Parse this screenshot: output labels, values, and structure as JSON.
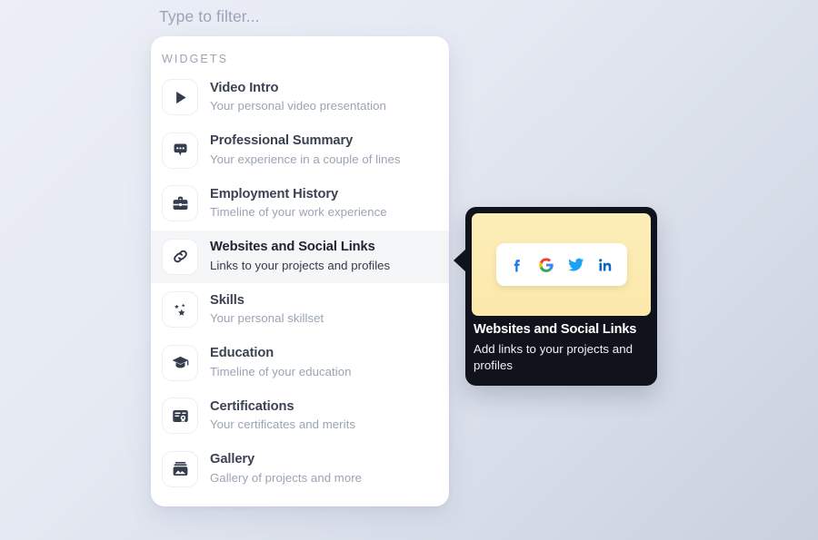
{
  "filter": {
    "placeholder": "Type to filter...",
    "value": ""
  },
  "panel": {
    "heading": "WIDGETS",
    "items": [
      {
        "icon": "play-icon",
        "title": "Video Intro",
        "subtitle": "Your personal video presentation",
        "selected": false
      },
      {
        "icon": "speech-bubble-icon",
        "title": "Professional Summary",
        "subtitle": "Your experience in a couple of lines",
        "selected": false
      },
      {
        "icon": "briefcase-icon",
        "title": "Employment History",
        "subtitle": "Timeline of your work experience",
        "selected": false
      },
      {
        "icon": "link-icon",
        "title": "Websites and Social Links",
        "subtitle": "Links to your projects and profiles",
        "selected": true
      },
      {
        "icon": "sparkle-stars-icon",
        "title": "Skills",
        "subtitle": "Your personal skillset",
        "selected": false
      },
      {
        "icon": "graduation-cap-icon",
        "title": "Education",
        "subtitle": "Timeline of your education",
        "selected": false
      },
      {
        "icon": "certificate-icon",
        "title": "Certifications",
        "subtitle": "Your certificates and merits",
        "selected": false
      },
      {
        "icon": "gallery-image-icon",
        "title": "Gallery",
        "subtitle": "Gallery of projects and more",
        "selected": false
      }
    ]
  },
  "preview": {
    "title": "Websites and Social Links",
    "description": "Add links to your projects and profiles",
    "social_icons": [
      {
        "name": "facebook-icon",
        "label": "f",
        "color": "#1877F2"
      },
      {
        "name": "google-icon",
        "label": "G",
        "color": "#4285F4"
      },
      {
        "name": "twitter-icon",
        "label": "twitter bird",
        "color": "#1DA1F2"
      },
      {
        "name": "linkedin-icon",
        "label": "in",
        "color": "#0A66C2"
      }
    ]
  },
  "colors": {
    "card_background": "#ffffff",
    "preview_background": "#10131c",
    "preview_accent": "#fbe8ab",
    "selected_row": "#f5f6f8",
    "title_text": "#3b4252",
    "subtitle_text": "#9aa4b4",
    "heading_text": "#9ba4b4"
  }
}
